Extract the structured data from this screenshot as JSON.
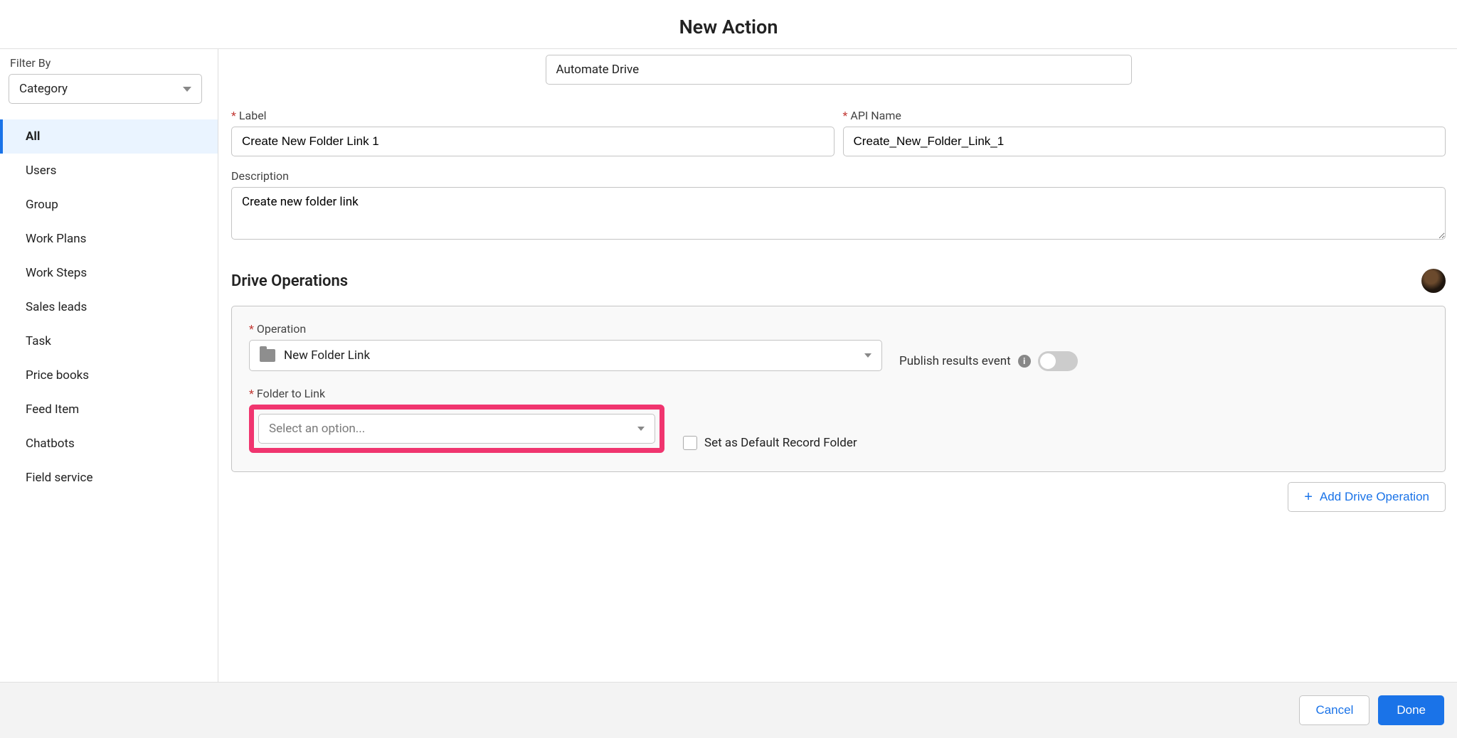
{
  "page_title": "New Action",
  "sidebar": {
    "filter_label": "Filter By",
    "filter_value": "Category",
    "items": [
      {
        "label": "All",
        "active": true
      },
      {
        "label": "Users"
      },
      {
        "label": "Group"
      },
      {
        "label": "Work Plans"
      },
      {
        "label": "Work Steps"
      },
      {
        "label": "Sales leads"
      },
      {
        "label": "Task"
      },
      {
        "label": "Price books"
      },
      {
        "label": "Feed Item"
      },
      {
        "label": "Chatbots"
      },
      {
        "label": "Field service"
      }
    ]
  },
  "top_name_value": "Automate Drive",
  "fields": {
    "label_label": "Label",
    "label_value": "Create New Folder Link 1",
    "api_label": "API Name",
    "api_value": "Create_New_Folder_Link_1",
    "desc_label": "Description",
    "desc_value": "Create new folder link"
  },
  "drive_section": {
    "heading": "Drive Operations",
    "operation_label": "Operation",
    "operation_value": "New Folder Link",
    "publish_label": "Publish results event",
    "folder_label": "Folder to Link",
    "folder_placeholder": "Select an option...",
    "checkbox_label": "Set as Default Record Folder",
    "add_button": "Add Drive Operation"
  },
  "footer": {
    "cancel": "Cancel",
    "done": "Done"
  }
}
